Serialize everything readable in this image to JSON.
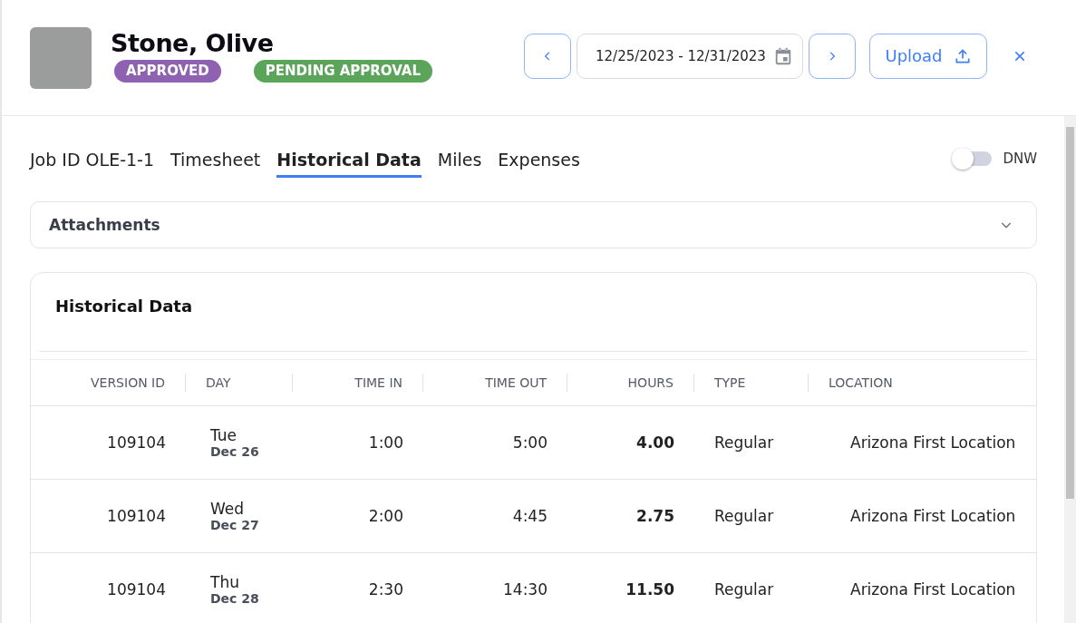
{
  "employee": {
    "name": "Stone, Olive",
    "badges": [
      {
        "label": "APPROVED",
        "color": "#8e62b0"
      },
      {
        "label": "PENDING APPROVAL",
        "color": "#5aa55a"
      }
    ]
  },
  "date_range": {
    "value": "12/25/2023 - 12/31/2023"
  },
  "upload_button": "Upload",
  "tabs": [
    {
      "label": "Job ID OLE-1-1",
      "selected": false
    },
    {
      "label": "Timesheet",
      "selected": false
    },
    {
      "label": "Historical Data",
      "selected": true
    },
    {
      "label": "Miles",
      "selected": false
    },
    {
      "label": "Expenses",
      "selected": false
    }
  ],
  "dnw_toggle": {
    "label": "DNW",
    "on": false
  },
  "attachments": {
    "title": "Attachments",
    "expanded": false
  },
  "historical": {
    "title": "Historical Data",
    "columns": [
      "VERSION ID",
      "DAY",
      "TIME IN",
      "TIME OUT",
      "HOURS",
      "TYPE",
      "LOCATION"
    ],
    "rows": [
      {
        "version_id": "109104",
        "weekday": "Tue",
        "date": "Dec 26",
        "time_in": "1:00",
        "time_out": "5:00",
        "hours": "4.00",
        "type": "Regular",
        "location": "Arizona First Location"
      },
      {
        "version_id": "109104",
        "weekday": "Wed",
        "date": "Dec 27",
        "time_in": "2:00",
        "time_out": "4:45",
        "hours": "2.75",
        "type": "Regular",
        "location": "Arizona First Location"
      },
      {
        "version_id": "109104",
        "weekday": "Thu",
        "date": "Dec 28",
        "time_in": "2:30",
        "time_out": "14:30",
        "hours": "11.50",
        "type": "Regular",
        "location": "Arizona First Location"
      }
    ]
  }
}
